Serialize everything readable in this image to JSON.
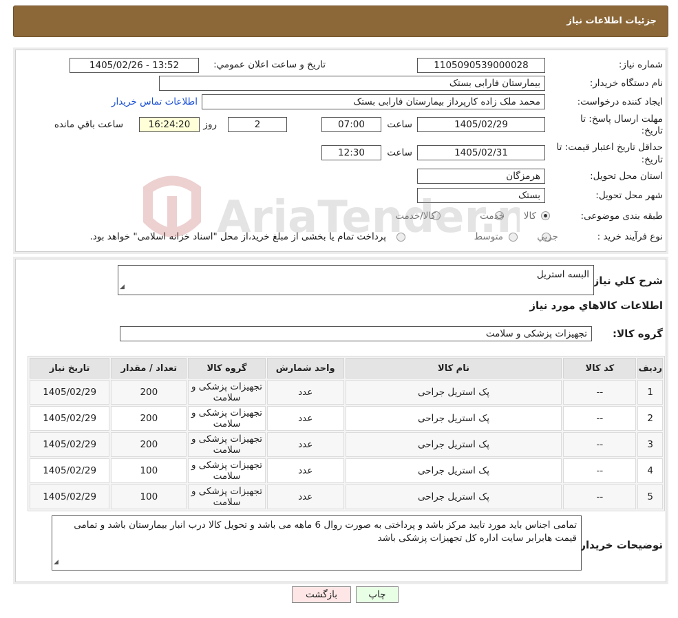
{
  "header": {
    "title": "جزئیات اطلاعات نیاز"
  },
  "form": {
    "need_number_label": "شماره نیاز:",
    "need_number": "1105090539000028",
    "announce_label": "تاریخ و ساعت اعلان عمومي:",
    "announce_value": "1405/02/26 - 13:52",
    "buyer_org_label": "نام دستگاه خریدار:",
    "buyer_org": "بیمارستان فارابی بستک",
    "creator_label": "ایجاد کننده درخواست:",
    "creator": "محمد ملک زاده کارپرداز بیمارستان فارابی بستک",
    "contact_link": "اطلاعات تماس خریدار",
    "deadline_label_1": "مهلت ارسال پاسخ: تا",
    "deadline_label_2": "تاریخ:",
    "deadline_date": "1405/02/29",
    "time_label": "ساعت",
    "deadline_time": "07:00",
    "days_value": "2",
    "days_label": "روز و",
    "remaining_time": "16:24:20",
    "remaining_label": "ساعت باقي مانده",
    "validity_label_1": "حداقل تاریخ اعتبار قیمت: تا",
    "validity_label_2": "تاریخ:",
    "validity_date": "1405/02/31",
    "validity_time": "12:30",
    "province_label": "استان محل تحویل:",
    "province": "هرمزگان",
    "city_label": "شهر محل تحویل:",
    "city": "بستک",
    "category_label": "طبقه بندی موضوعی:",
    "category_options": [
      "کالا",
      "خدمت",
      "کالا/خدمت"
    ],
    "process_label": "نوع فرآیند خرید :",
    "process_options": [
      "جزيي",
      "متوسط"
    ],
    "process_note": "پرداخت تمام یا بخشی از مبلغ خرید،از محل \"اسناد خزانه اسلامی\" خواهد بود."
  },
  "details": {
    "summary_label": "شرح كلي نياز:",
    "summary": "البسه استریل",
    "items_heading": "اطلاعات كالاهاي مورد نياز",
    "group_label": "گروه کالا:",
    "group": "تجهیزات پزشکی و سلامت",
    "table": {
      "headers": [
        "رديف",
        "کد کالا",
        "نام کالا",
        "واحد شمارش",
        "گروه کالا",
        "تعداد / مقدار",
        "تاریخ نیاز"
      ],
      "rows": [
        [
          "1",
          "--",
          "پک استریل جراحی",
          "عدد",
          "تجهیزات پزشکی و سلامت",
          "200",
          "1405/02/29"
        ],
        [
          "2",
          "--",
          "پک استریل جراحی",
          "عدد",
          "تجهیزات پزشکی و سلامت",
          "200",
          "1405/02/29"
        ],
        [
          "3",
          "--",
          "پک استریل جراحی",
          "عدد",
          "تجهیزات پزشکی و سلامت",
          "200",
          "1405/02/29"
        ],
        [
          "4",
          "--",
          "پک استریل جراحی",
          "عدد",
          "تجهیزات پزشکی و سلامت",
          "100",
          "1405/02/29"
        ],
        [
          "5",
          "--",
          "پک استریل جراحی",
          "عدد",
          "تجهیزات پزشکی و سلامت",
          "100",
          "1405/02/29"
        ]
      ]
    },
    "buyer_notes_label": "توضیحات خریدار:",
    "buyer_notes": "تمامی اجناس باید مورد تایید مرکز باشد و پرداختی به صورت روال 6 ماهه می باشد و تحویل کالا درب انبار بیمارستان باشد و تمامی قیمت هابرابر سایت اداره کل تجهیزات پزشکی باشد"
  },
  "buttons": {
    "print": "چاپ",
    "back": "بازگشت"
  },
  "watermark": {
    "text": "AriaTender.neT"
  },
  "colors": {
    "header_bg": "#8c6839",
    "link": "#1a4fd6",
    "remaining_bg": "#ffffd8",
    "print_bg": "#e8ffe6",
    "back_bg": "#ffe6e6"
  }
}
